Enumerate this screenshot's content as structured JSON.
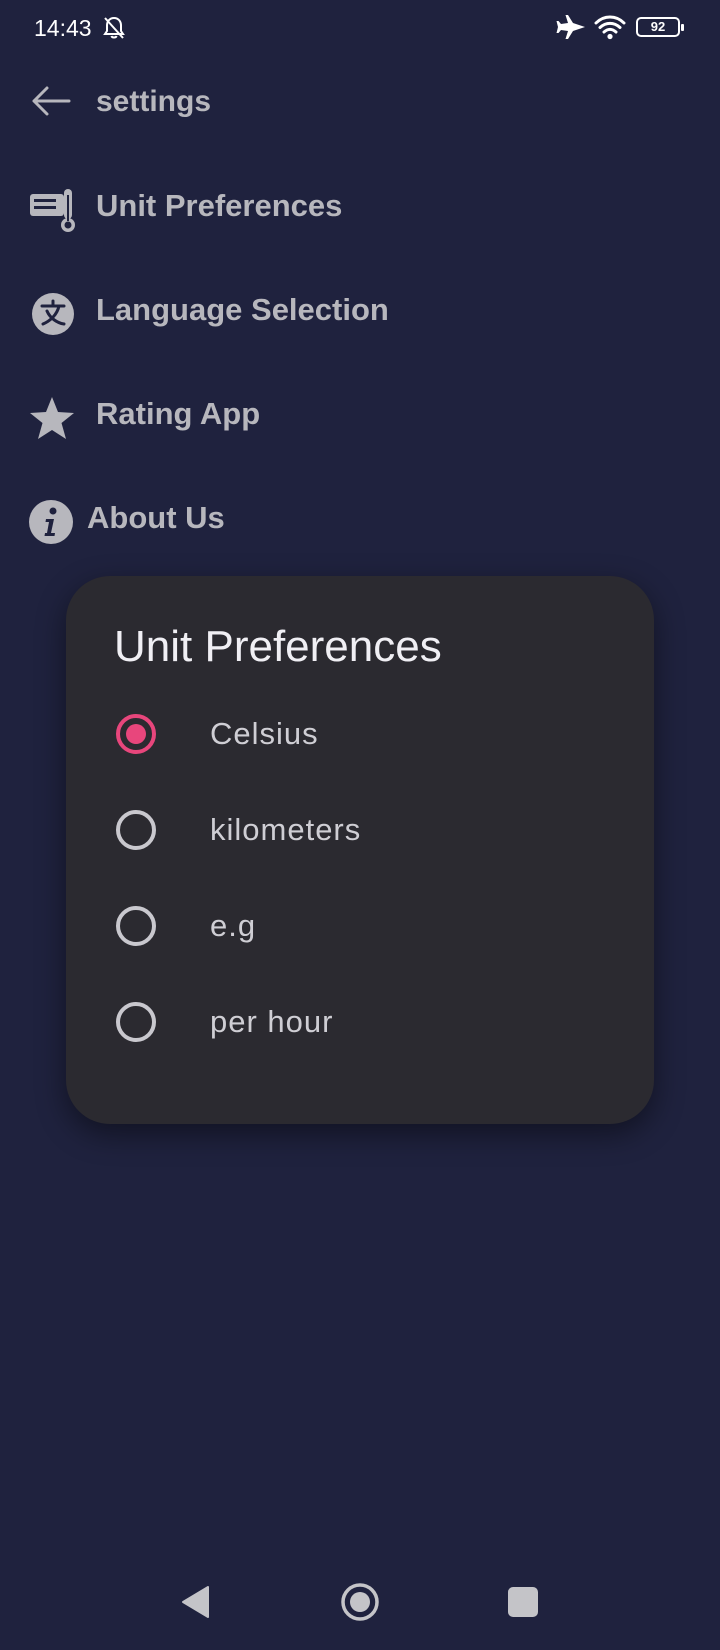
{
  "status_bar": {
    "time": "14:43",
    "battery": "92",
    "icons": [
      "bell-off-icon",
      "airplane-icon",
      "wifi-icon",
      "battery-icon"
    ]
  },
  "header": {
    "title": "settings",
    "back_icon": "arrow-left-icon"
  },
  "settings_items": [
    {
      "label": "Unit Preferences",
      "icon": "thermometer-card-icon"
    },
    {
      "label": "Language Selection",
      "icon": "translate-icon"
    },
    {
      "label": "Rating App",
      "icon": "star-icon"
    },
    {
      "label": "About Us",
      "icon": "info-icon"
    }
  ],
  "dialog": {
    "title": "Unit Preferences",
    "options": [
      {
        "label": "Celsius",
        "selected": true
      },
      {
        "label": "kilometers",
        "selected": false
      },
      {
        "label": "e.g",
        "selected": false
      },
      {
        "label": "per hour",
        "selected": false
      }
    ]
  },
  "nav_bar": {
    "icons": [
      "nav-back-icon",
      "nav-home-icon",
      "nav-recents-icon"
    ]
  },
  "colors": {
    "background": "#1f223e",
    "dialog": "#2b2a30",
    "accent": "#e8467c",
    "text_muted": "#b7b7bd"
  }
}
